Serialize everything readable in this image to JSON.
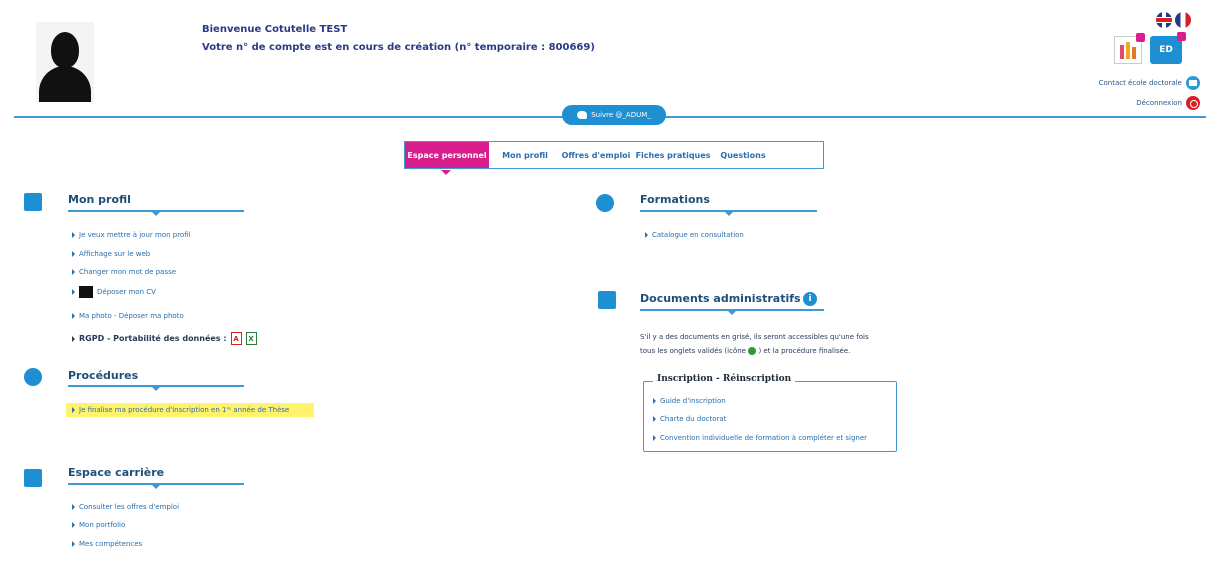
{
  "header": {
    "welcome": "Bienvenue Cotutelle TEST",
    "account_status": "Votre n° de compte est en cours de création (n° temporaire : 800669)",
    "twitter_label": "Suivre @_ADUM_",
    "contact_label": "Contact école doctorale",
    "logout_label": "Déconnexion",
    "ed_icon_label": "ED"
  },
  "tabs": [
    {
      "label": "Espace personnel",
      "active": true
    },
    {
      "label": "Mon profil",
      "active": false
    },
    {
      "label": "Offres d'emploi",
      "active": false
    },
    {
      "label": "Fiches pratiques",
      "active": false
    },
    {
      "label": "Questions",
      "active": false
    }
  ],
  "profil": {
    "title": "Mon profil",
    "links": [
      "Je veux mettre à jour mon profil",
      "Affichage sur le web",
      "Changer mon mot de passe",
      "Déposer mon CV",
      "Ma photo - Déposer ma photo"
    ],
    "rgpd_label": "RGPD - Portabilité des données :"
  },
  "procedures": {
    "title": "Procédures",
    "links": [
      "Je finalise ma procédure d'inscription en 1ʳᵉ année de Thèse"
    ]
  },
  "carriere": {
    "title": "Espace carrière",
    "links": [
      "Consulter les offres d'emploi",
      "Mon portfolio",
      "Mes compétences"
    ]
  },
  "formations": {
    "title": "Formations",
    "links": [
      "Catalogue en consultation"
    ]
  },
  "documents": {
    "title": "Documents administratifs",
    "info_glyph": "i",
    "text_line1": "S'il y a des documents en grisé, ils seront accessibles qu'une fois",
    "text_line2_a": "tous les onglets validés (icône",
    "text_line2_b": ") et la procédure finalisée.",
    "fieldset_legend": "Inscription - Réinscription",
    "links": [
      "Guide d'inscription",
      "Charte du doctorat",
      "Convention individuelle de formation à compléter et signer"
    ]
  },
  "colors": {
    "accent": "#1e8fd2",
    "active_tab": "#d81e8c",
    "highlight": "#fff36b"
  }
}
